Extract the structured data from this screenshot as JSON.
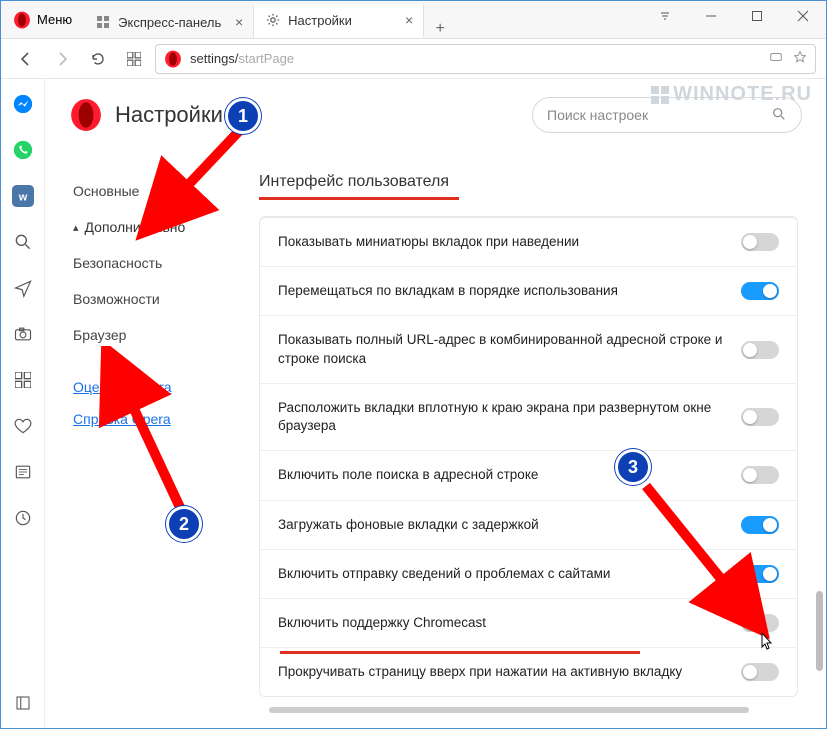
{
  "menu_label": "Меню",
  "tabs": [
    {
      "label": "Экспресс-панель"
    },
    {
      "label": "Настройки"
    }
  ],
  "url_prefix": "settings/",
  "url_path": "startPage",
  "page_title": "Настройки",
  "search_placeholder": "Поиск настроек",
  "sidebar": {
    "basic": "Основные",
    "advanced": "Дополнительно",
    "security": "Безопасность",
    "features": "Возможности",
    "browser": "Браузер",
    "rate_link": "Оценить Opera",
    "help_link": "Справка Opera"
  },
  "section_title": "Интерфейс пользователя",
  "settings": [
    {
      "label": "Показывать миниатюры вкладок при наведении",
      "on": false
    },
    {
      "label": "Перемещаться по вкладкам в порядке использования",
      "on": true
    },
    {
      "label": "Показывать полный URL-адрес в комбинированной адресной строке и строке поиска",
      "on": false
    },
    {
      "label": "Расположить вкладки вплотную к краю экрана при развернутом окне браузера",
      "on": false
    },
    {
      "label": "Включить поле поиска в адресной строке",
      "on": false
    },
    {
      "label": "Загружать фоновые вкладки с задержкой",
      "on": true
    },
    {
      "label": "Включить отправку сведений о проблемах с сайтами",
      "on": true
    },
    {
      "label": "Включить поддержку Chromecast",
      "on": false
    },
    {
      "label": "Прокручивать страницу вверх при нажатии на активную вкладку",
      "on": false
    }
  ],
  "badges": {
    "one": "1",
    "two": "2",
    "three": "3"
  },
  "watermark": "WINNOTE.RU"
}
